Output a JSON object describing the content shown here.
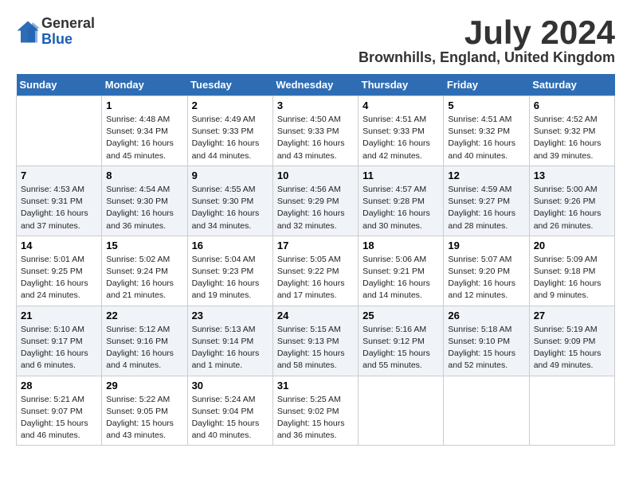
{
  "header": {
    "logo_general": "General",
    "logo_blue": "Blue",
    "month_title": "July 2024",
    "location": "Brownhills, England, United Kingdom"
  },
  "calendar": {
    "days_of_week": [
      "Sunday",
      "Monday",
      "Tuesday",
      "Wednesday",
      "Thursday",
      "Friday",
      "Saturday"
    ],
    "weeks": [
      {
        "days": [
          {
            "num": "",
            "info": ""
          },
          {
            "num": "1",
            "info": "Sunrise: 4:48 AM\nSunset: 9:34 PM\nDaylight: 16 hours\nand 45 minutes."
          },
          {
            "num": "2",
            "info": "Sunrise: 4:49 AM\nSunset: 9:33 PM\nDaylight: 16 hours\nand 44 minutes."
          },
          {
            "num": "3",
            "info": "Sunrise: 4:50 AM\nSunset: 9:33 PM\nDaylight: 16 hours\nand 43 minutes."
          },
          {
            "num": "4",
            "info": "Sunrise: 4:51 AM\nSunset: 9:33 PM\nDaylight: 16 hours\nand 42 minutes."
          },
          {
            "num": "5",
            "info": "Sunrise: 4:51 AM\nSunset: 9:32 PM\nDaylight: 16 hours\nand 40 minutes."
          },
          {
            "num": "6",
            "info": "Sunrise: 4:52 AM\nSunset: 9:32 PM\nDaylight: 16 hours\nand 39 minutes."
          }
        ]
      },
      {
        "days": [
          {
            "num": "7",
            "info": "Sunrise: 4:53 AM\nSunset: 9:31 PM\nDaylight: 16 hours\nand 37 minutes."
          },
          {
            "num": "8",
            "info": "Sunrise: 4:54 AM\nSunset: 9:30 PM\nDaylight: 16 hours\nand 36 minutes."
          },
          {
            "num": "9",
            "info": "Sunrise: 4:55 AM\nSunset: 9:30 PM\nDaylight: 16 hours\nand 34 minutes."
          },
          {
            "num": "10",
            "info": "Sunrise: 4:56 AM\nSunset: 9:29 PM\nDaylight: 16 hours\nand 32 minutes."
          },
          {
            "num": "11",
            "info": "Sunrise: 4:57 AM\nSunset: 9:28 PM\nDaylight: 16 hours\nand 30 minutes."
          },
          {
            "num": "12",
            "info": "Sunrise: 4:59 AM\nSunset: 9:27 PM\nDaylight: 16 hours\nand 28 minutes."
          },
          {
            "num": "13",
            "info": "Sunrise: 5:00 AM\nSunset: 9:26 PM\nDaylight: 16 hours\nand 26 minutes."
          }
        ]
      },
      {
        "days": [
          {
            "num": "14",
            "info": "Sunrise: 5:01 AM\nSunset: 9:25 PM\nDaylight: 16 hours\nand 24 minutes."
          },
          {
            "num": "15",
            "info": "Sunrise: 5:02 AM\nSunset: 9:24 PM\nDaylight: 16 hours\nand 21 minutes."
          },
          {
            "num": "16",
            "info": "Sunrise: 5:04 AM\nSunset: 9:23 PM\nDaylight: 16 hours\nand 19 minutes."
          },
          {
            "num": "17",
            "info": "Sunrise: 5:05 AM\nSunset: 9:22 PM\nDaylight: 16 hours\nand 17 minutes."
          },
          {
            "num": "18",
            "info": "Sunrise: 5:06 AM\nSunset: 9:21 PM\nDaylight: 16 hours\nand 14 minutes."
          },
          {
            "num": "19",
            "info": "Sunrise: 5:07 AM\nSunset: 9:20 PM\nDaylight: 16 hours\nand 12 minutes."
          },
          {
            "num": "20",
            "info": "Sunrise: 5:09 AM\nSunset: 9:18 PM\nDaylight: 16 hours\nand 9 minutes."
          }
        ]
      },
      {
        "days": [
          {
            "num": "21",
            "info": "Sunrise: 5:10 AM\nSunset: 9:17 PM\nDaylight: 16 hours\nand 6 minutes."
          },
          {
            "num": "22",
            "info": "Sunrise: 5:12 AM\nSunset: 9:16 PM\nDaylight: 16 hours\nand 4 minutes."
          },
          {
            "num": "23",
            "info": "Sunrise: 5:13 AM\nSunset: 9:14 PM\nDaylight: 16 hours\nand 1 minute."
          },
          {
            "num": "24",
            "info": "Sunrise: 5:15 AM\nSunset: 9:13 PM\nDaylight: 15 hours\nand 58 minutes."
          },
          {
            "num": "25",
            "info": "Sunrise: 5:16 AM\nSunset: 9:12 PM\nDaylight: 15 hours\nand 55 minutes."
          },
          {
            "num": "26",
            "info": "Sunrise: 5:18 AM\nSunset: 9:10 PM\nDaylight: 15 hours\nand 52 minutes."
          },
          {
            "num": "27",
            "info": "Sunrise: 5:19 AM\nSunset: 9:09 PM\nDaylight: 15 hours\nand 49 minutes."
          }
        ]
      },
      {
        "days": [
          {
            "num": "28",
            "info": "Sunrise: 5:21 AM\nSunset: 9:07 PM\nDaylight: 15 hours\nand 46 minutes."
          },
          {
            "num": "29",
            "info": "Sunrise: 5:22 AM\nSunset: 9:05 PM\nDaylight: 15 hours\nand 43 minutes."
          },
          {
            "num": "30",
            "info": "Sunrise: 5:24 AM\nSunset: 9:04 PM\nDaylight: 15 hours\nand 40 minutes."
          },
          {
            "num": "31",
            "info": "Sunrise: 5:25 AM\nSunset: 9:02 PM\nDaylight: 15 hours\nand 36 minutes."
          },
          {
            "num": "",
            "info": ""
          },
          {
            "num": "",
            "info": ""
          },
          {
            "num": "",
            "info": ""
          }
        ]
      }
    ]
  }
}
